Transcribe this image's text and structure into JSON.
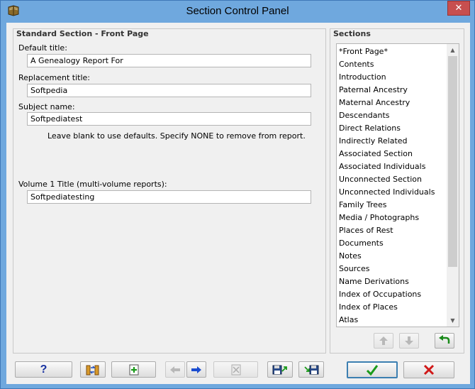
{
  "window": {
    "title": "Section Control Panel",
    "close_label": "✕"
  },
  "left_panel": {
    "group_title": "Standard Section - Front Page",
    "fields": [
      {
        "label": "Default title:",
        "value": "A Genealogy Report For"
      },
      {
        "label": "Replacement title:",
        "value": "Softpedia"
      },
      {
        "label": "Subject name:",
        "value": "Softpediatest"
      }
    ],
    "hint": "Leave blank to use defaults.  Specify NONE to remove from report.",
    "volume_field": {
      "label": "Volume 1 Title (multi-volume reports):",
      "value": "Softpediatesting"
    }
  },
  "sections_panel": {
    "group_title": "Sections",
    "items": [
      "*Front Page*",
      "Contents",
      "Introduction",
      "Paternal Ancestry",
      "Maternal Ancestry",
      "Descendants",
      "Direct Relations",
      "Indirectly Related",
      "Associated Section",
      "Associated Individuals",
      "Unconnected Section",
      "Unconnected Individuals",
      "Family Trees",
      "Media / Photographs",
      "Places of Rest",
      "Documents",
      "Notes",
      "Sources",
      "Name Derivations",
      "Index of Occupations",
      "Index of Places",
      "Atlas"
    ]
  },
  "toolbar": {
    "help_label": "?"
  },
  "colors": {
    "titlebar": "#6fa8de",
    "ok_green": "#1a9a1a",
    "cancel_red": "#d01818",
    "help_blue": "#1630a0"
  }
}
